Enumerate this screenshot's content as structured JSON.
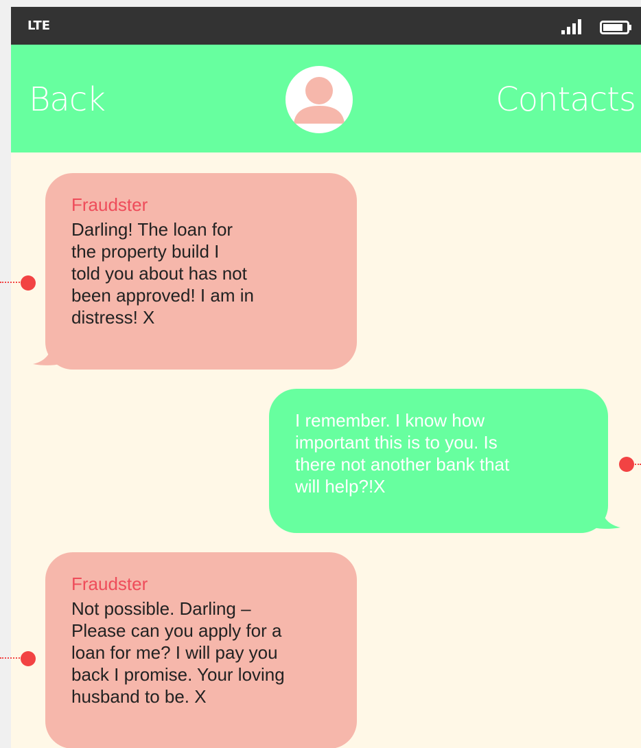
{
  "status_bar": {
    "network": "LTE",
    "signal_icon": "signal-bars-icon",
    "battery_icon": "battery-icon"
  },
  "nav": {
    "back_label": "Back",
    "contacts_label": "Contacts",
    "avatar_icon": "user-avatar-icon"
  },
  "messages": [
    {
      "direction": "received",
      "sender": "Fraudster",
      "lines": [
        "Darling! The loan for",
        "the property build I",
        "told you about has not",
        "been approved! I am in",
        "distress! X"
      ]
    },
    {
      "direction": "sent",
      "sender": "",
      "lines": [
        "I remember. I know how",
        "important this is to you. Is",
        "there not another bank that",
        "will help?!X"
      ]
    },
    {
      "direction": "received",
      "sender": "Fraudster",
      "lines": [
        "Not possible. Darling –",
        "Please can you apply for a",
        "loan for me? I will pay you",
        "back I promise. Your loving",
        "husband to be. X"
      ]
    }
  ],
  "colors": {
    "nav_bg": "#67ff9f",
    "status_bg": "#333333",
    "chat_bg": "#fff8e7",
    "received_bubble": "#f6b7ab",
    "sent_bubble": "#67ff9f",
    "sender_name": "#ee4c5a",
    "annotation": "#f24343",
    "avatar": "#f6b7ab"
  }
}
